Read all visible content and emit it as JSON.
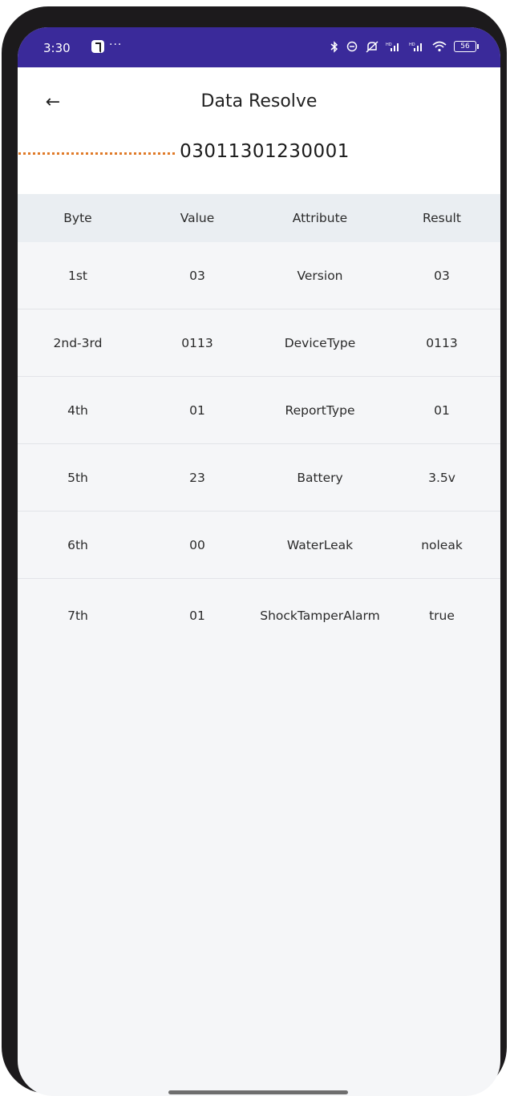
{
  "status_bar": {
    "time": "3:30",
    "dots": "···",
    "battery": "56",
    "icons": [
      "tiktok-icon",
      "bluetooth-icon",
      "link-icon",
      "mute-icon",
      "signal-icon",
      "signal-icon",
      "wifi-icon",
      "battery-icon"
    ]
  },
  "header": {
    "back_icon": "←",
    "title": "Data Resolve",
    "raw_data": "03011301230001"
  },
  "colors": {
    "status_bar": "#3a2a9a",
    "leader_line": "#e07a28",
    "table_header": "#eaeef2",
    "background": "#f5f6f8"
  },
  "table": {
    "headers": [
      "Byte",
      "Value",
      "Attribute",
      "Result"
    ],
    "rows": [
      [
        "1st",
        "03",
        "Version",
        "03"
      ],
      [
        "2nd-3rd",
        "0113",
        "DeviceType",
        "0113"
      ],
      [
        "4th",
        "01",
        "ReportType",
        "01"
      ],
      [
        "5th",
        "23",
        "Battery",
        "3.5v"
      ],
      [
        "6th",
        "00",
        "WaterLeak",
        "noleak"
      ],
      [
        "7th",
        "01",
        "ShockTamperAlarm",
        "true"
      ]
    ]
  }
}
